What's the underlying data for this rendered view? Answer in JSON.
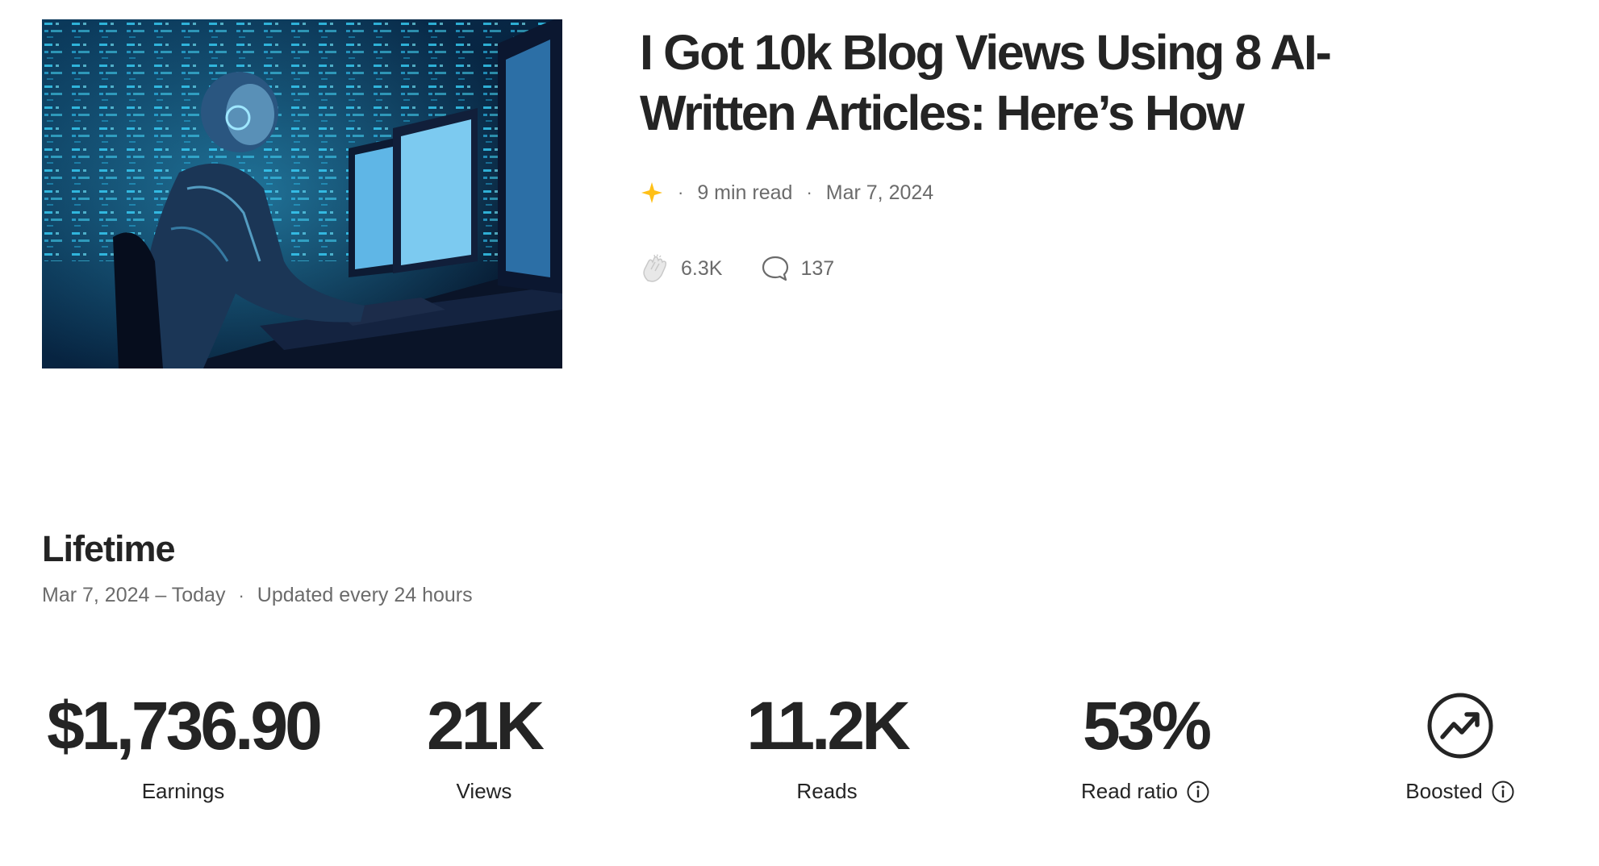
{
  "article": {
    "title": "I Got 10k Blog Views Using 8 AI-Written Articles: Here’s How",
    "read_time": "9 min read",
    "date": "Mar 7, 2024",
    "claps": "6.3K",
    "responses": "137",
    "thumbnail_icon": "robot-at-computer-image"
  },
  "lifetime": {
    "heading": "Lifetime",
    "range": "Mar 7, 2024 – Today",
    "updated": "Updated every 24 hours"
  },
  "metrics": {
    "earnings": {
      "value": "$1,736.90",
      "label": "Earnings"
    },
    "views": {
      "value": "21K",
      "label": "Views"
    },
    "reads": {
      "value": "11.2K",
      "label": "Reads"
    },
    "read_ratio": {
      "value": "53%",
      "label": "Read ratio"
    },
    "boosted": {
      "label": "Boosted",
      "icon": "trending-up-icon"
    }
  },
  "colors": {
    "text": "#242424",
    "muted": "#6b6b6b",
    "star": "#FFC017"
  }
}
